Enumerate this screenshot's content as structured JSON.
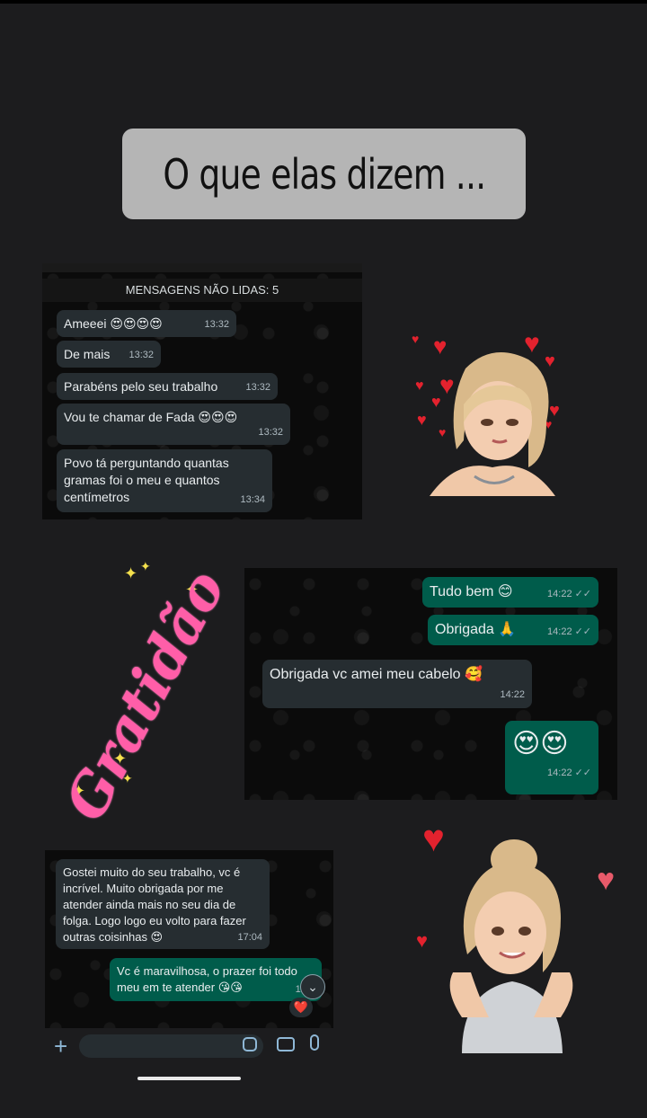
{
  "title": "O que elas dizem ...",
  "chat1": {
    "unread_label": "MENSAGENS NÃO LIDAS: 5",
    "messages": [
      {
        "text": "Ameeei 😍😍😍😍",
        "time": "13:32"
      },
      {
        "text": "De mais",
        "time": "13:32"
      },
      {
        "text": "Parabéns pelo seu trabalho",
        "time": "13:32"
      },
      {
        "text": "Vou te chamar de Fada 😍😍😍",
        "time": "13:32"
      },
      {
        "text": "Povo tá perguntando quantas gramas foi o meu e quantos centímetros",
        "time": "13:34"
      }
    ]
  },
  "chat2": {
    "messages": [
      {
        "text": "Tudo bem 😊",
        "time": "14:22"
      },
      {
        "text": "Obrigada 🙏",
        "time": "14:22"
      },
      {
        "text": "Obrigada vc amei meu cabelo 🥰",
        "time": "14:22"
      },
      {
        "text": "😍😍",
        "time": "14:22"
      }
    ]
  },
  "chat3": {
    "messages": [
      {
        "text": "Gostei muito do seu trabalho, vc é incrível. Muito obrigada por me atender ainda mais no seu dia de folga. Logo logo eu volto para fazer outras coisinhas 😍",
        "time": "17:04"
      },
      {
        "text": "Vc é maravilhosa, o prazer foi todo meu em te atender 😘😘",
        "time": "17:0"
      }
    ],
    "reaction": "❤️"
  },
  "sticker_word": "Gratidão",
  "icons": {
    "heart": "heart-icon",
    "check": "double-check-icon",
    "plus": "plus-icon",
    "camera": "camera-icon",
    "mic": "microphone-icon",
    "sticker": "sticker-icon",
    "scroll": "chevron-down-icon"
  },
  "colors": {
    "background": "#1c1c1e",
    "incoming": "#262d31",
    "outgoing": "#005c4b",
    "heart": "#e3222e",
    "gratidao": "#ff5ea8"
  }
}
